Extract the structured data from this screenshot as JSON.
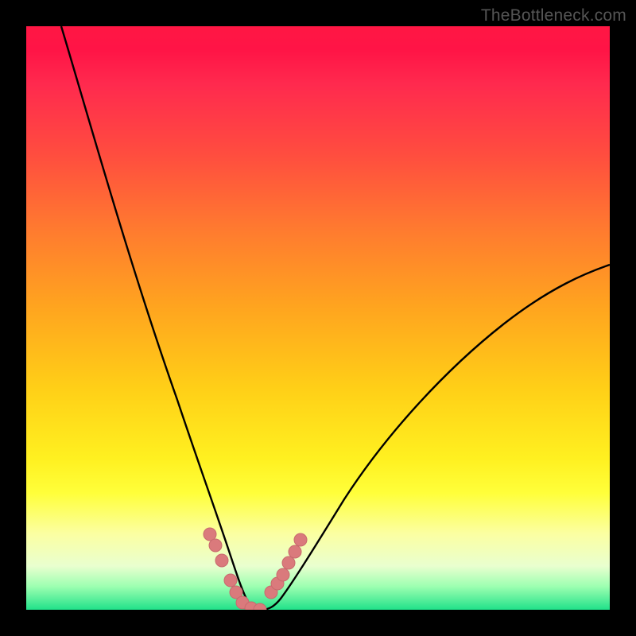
{
  "watermark": {
    "text": "TheBottleneck.com"
  },
  "colors": {
    "curve_stroke": "#000000",
    "marker_fill": "#da7a7c",
    "marker_stroke": "#c86a6e",
    "background_black": "#000000"
  },
  "chart_data": {
    "type": "line",
    "title": "",
    "xlabel": "",
    "ylabel": "",
    "xlim": [
      0,
      100
    ],
    "ylim": [
      0,
      100
    ],
    "grid": false,
    "legend": false,
    "note": "Decorative bottleneck V-chart; no axes or tick labels rendered. Values are estimated from pixel positions.",
    "series": [
      {
        "name": "left-curve",
        "x": [
          6,
          10,
          15,
          20,
          25,
          28,
          30,
          32,
          34,
          35,
          36,
          37,
          38
        ],
        "y": [
          100,
          83,
          64,
          46,
          29,
          20,
          15,
          10,
          5,
          3,
          1.5,
          0.5,
          0
        ]
      },
      {
        "name": "right-curve",
        "x": [
          38,
          40,
          42,
          45,
          48,
          52,
          58,
          65,
          72,
          80,
          88,
          95,
          100
        ],
        "y": [
          0,
          0.5,
          1.5,
          4,
          8,
          14,
          23,
          32,
          40,
          46,
          52,
          56,
          59
        ]
      },
      {
        "name": "markers-left",
        "type": "scatter",
        "x": [
          31.5,
          32.5,
          33.5,
          35.0,
          36.0,
          37.0,
          38.5,
          40.0
        ],
        "y": [
          13.0,
          11.0,
          8.5,
          5.0,
          3.0,
          1.2,
          0.3,
          0.0
        ]
      },
      {
        "name": "markers-right",
        "type": "scatter",
        "x": [
          42.0,
          43.0,
          44.0,
          45.0,
          46.0,
          47.0
        ],
        "y": [
          3.0,
          4.5,
          6.0,
          8.0,
          10.0,
          12.0
        ]
      }
    ]
  }
}
